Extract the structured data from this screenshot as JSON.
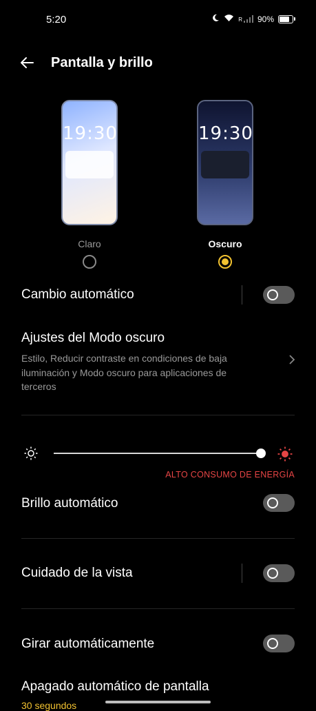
{
  "status_bar": {
    "time": "5:20",
    "signal_label": "R",
    "battery": "90%"
  },
  "header": {
    "title": "Pantalla y brillo"
  },
  "theme": {
    "preview_time": "19:30",
    "light_label": "Claro",
    "dark_label": "Oscuro",
    "selected": "Oscuro"
  },
  "rows": {
    "auto_switch": "Cambio automático",
    "dark_settings_title": "Ajustes del Modo oscuro",
    "dark_settings_sub": "Estilo, Reducir contraste en condiciones de baja iluminación y Modo oscuro para aplicaciones de terceros",
    "auto_brightness": "Brillo automático",
    "eye_care": "Cuidado de la vista",
    "auto_rotate": "Girar automáticamente",
    "screen_timeout": "Apagado automático de pantalla",
    "screen_timeout_value": "30 segundos"
  },
  "brightness": {
    "level": 1.0,
    "warning": "ALTO CONSUMO DE ENERGÍA"
  },
  "toggles": {
    "auto_switch": false,
    "auto_brightness": false,
    "eye_care": false,
    "auto_rotate": false
  },
  "colors": {
    "accent": "#f2c230",
    "warning": "#e64545"
  }
}
